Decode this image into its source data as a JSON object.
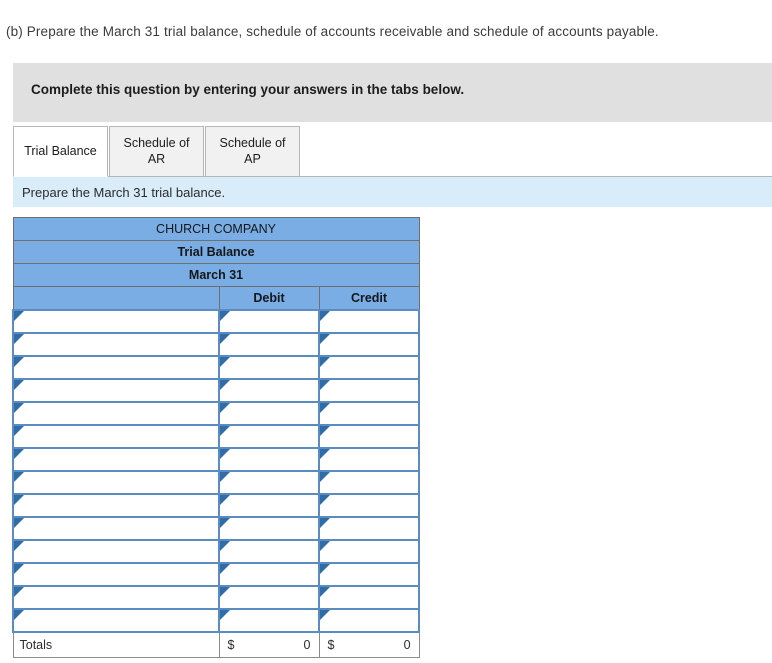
{
  "question": {
    "prompt": "(b) Prepare the March 31 trial balance, schedule of accounts receivable and schedule of accounts payable."
  },
  "instruction_banner": {
    "text": "Complete this question by entering your answers in the tabs below."
  },
  "tabs": [
    {
      "label": "Trial Balance",
      "active": true
    },
    {
      "label": "Schedule of AR",
      "active": false
    },
    {
      "label": "Schedule of AP",
      "active": false
    }
  ],
  "sub_instruction": {
    "text": "Prepare the March 31 trial balance."
  },
  "trial_balance": {
    "company": "CHURCH COMPANY",
    "statement": "Trial Balance",
    "date": "March 31",
    "columns": {
      "account": "",
      "debit": "Debit",
      "credit": "Credit"
    },
    "rows": [
      {
        "account": "",
        "debit": "",
        "credit": ""
      },
      {
        "account": "",
        "debit": "",
        "credit": ""
      },
      {
        "account": "",
        "debit": "",
        "credit": ""
      },
      {
        "account": "",
        "debit": "",
        "credit": ""
      },
      {
        "account": "",
        "debit": "",
        "credit": ""
      },
      {
        "account": "",
        "debit": "",
        "credit": ""
      },
      {
        "account": "",
        "debit": "",
        "credit": ""
      },
      {
        "account": "",
        "debit": "",
        "credit": ""
      },
      {
        "account": "",
        "debit": "",
        "credit": ""
      },
      {
        "account": "",
        "debit": "",
        "credit": ""
      },
      {
        "account": "",
        "debit": "",
        "credit": ""
      },
      {
        "account": "",
        "debit": "",
        "credit": ""
      },
      {
        "account": "",
        "debit": "",
        "credit": ""
      },
      {
        "account": "",
        "debit": "",
        "credit": ""
      }
    ],
    "totals": {
      "label": "Totals",
      "debit_currency": "$",
      "debit_value": "0",
      "credit_currency": "$",
      "credit_value": "0"
    }
  },
  "colors": {
    "header_blue": "#7AADE4",
    "banner_gray": "#E0E0E0",
    "sub_instruction_blue": "#D9ECF9",
    "input_border_blue": "#5A8CC2",
    "marker_blue": "#2F6CA8"
  }
}
